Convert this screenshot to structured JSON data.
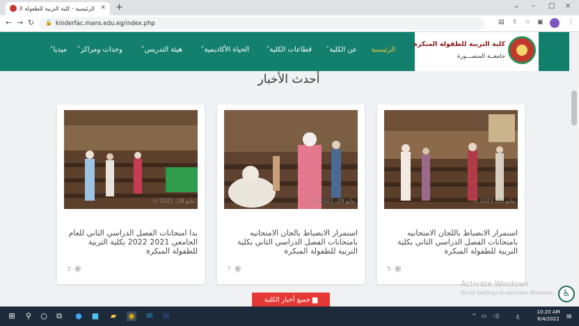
{
  "browser": {
    "tab_title": "الرئيسية - كلية التربية للطفولة المبـ",
    "tab_close": "×",
    "new_tab": "+",
    "url": "kinderfac.mans.edu.eg/index.php",
    "window_controls": [
      "⌄",
      "–",
      "▢",
      "×"
    ]
  },
  "site": {
    "logo_line1": "كلية التربية للطفولة المبكرة",
    "logo_line2": "جامعــة المنصـــورة",
    "menu": [
      {
        "label": "الرئيسية",
        "active": true
      },
      {
        "label": "عن الكلية˅",
        "active": false
      },
      {
        "label": "قطاعات الكلية˅",
        "active": false
      },
      {
        "label": "الحياة الأكاديمية˅",
        "active": false
      },
      {
        "label": "هيئة التدريس˅",
        "active": false
      },
      {
        "label": "وحدات ومراكز˅",
        "active": false
      },
      {
        "label": "ميديا˅",
        "active": false
      }
    ]
  },
  "news": {
    "section_title": "أحدث الأخبار",
    "cards": [
      {
        "date": "مايو 31, 2022 ⊙",
        "headline": "استمرار الانضباط باللجان الامتحانيه بامتحانات الفصل الدراسي الثاني بكلية التربية للطفولة المبكرة",
        "views": "5"
      },
      {
        "date": "مايو 29, 2022 ⊙",
        "headline": "استمرار الانضباط بالجان الامتحانيه بامتحانات الفصل الدراسي الثاني بكلية التربية للطفولة المبكرة",
        "views": "7"
      },
      {
        "date": "مايو 28, 2022 ⊙",
        "headline": "بدا امتحانات الفصل الدراسي الثاني للعام الجامعي 2021 2022 بكلية التربية للطفولة المبكرة",
        "views": "3"
      }
    ],
    "all_news_button": "جميع أخبار الكلية"
  },
  "watermark": {
    "line1": "Activate Windows",
    "line2": "Go to Settings to activate Windows."
  },
  "taskbar": {
    "time": "10:20 AM",
    "date": "6/4/2022",
    "lang": "ع"
  },
  "colors": {
    "header_green": "#12806d",
    "menu_active": "#f5c542",
    "button_red": "#e53935"
  }
}
